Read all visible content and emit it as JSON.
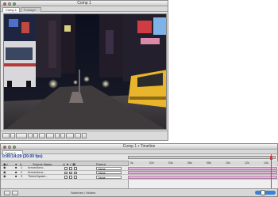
{
  "comp_window": {
    "title": "Comp 1",
    "tabs": [
      "Comp 1",
      "Footage: ..."
    ],
    "traffic_lights": [
      "close",
      "minimize",
      "zoom"
    ]
  },
  "timeline_window": {
    "title": "Comp 1 • Timeline",
    "tab": "Comp 1",
    "timecode": "0:00:14:29 (30.00 fps)",
    "headers": {
      "source_name": "Source Name",
      "parent": "Parent"
    },
    "ruler_ticks": [
      "0s",
      "02s",
      "04s",
      "06s",
      "08s",
      "10s",
      "12s",
      "14s"
    ],
    "layers": [
      {
        "num": "1",
        "name": "Arrow/Aero...",
        "parent": "None"
      },
      {
        "num": "2",
        "name": "Arrow/Aero...",
        "parent": "None"
      },
      {
        "num": "3",
        "name": "TimesSquare...",
        "parent": "None"
      }
    ],
    "bottom_label": "Switches / Modes"
  },
  "colors": {
    "timecode": "#1d3ea0",
    "layer_bar": "#e6b4d9",
    "playhead": "#d43a3a",
    "zoom_slider": "#3a7fd8"
  }
}
